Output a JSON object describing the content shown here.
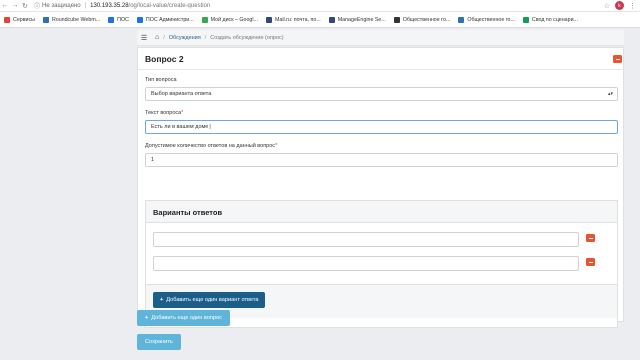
{
  "browser": {
    "security": "Не защищено",
    "url_host": "130.193.35.28",
    "url_path": "/og/local-value/create-question",
    "avatar_letter": "k"
  },
  "bookmarks": [
    {
      "label": "Сервисы",
      "color": "#e94235"
    },
    {
      "label": "Roundcube Webm...",
      "color": "#2f6fb5"
    },
    {
      "label": "ПОС",
      "color": "#1a73e8"
    },
    {
      "label": "ПОС Администри...",
      "color": "#1a73e8"
    },
    {
      "label": "Мой диск – Googl...",
      "color": "#34a853"
    },
    {
      "label": "Mail.ru: почта, по...",
      "color": "#2c4a7e"
    },
    {
      "label": "ManageEngine Se...",
      "color": "#2c4a7e"
    },
    {
      "label": "Общественное го...",
      "color": "#333333"
    },
    {
      "label": "Общественное го...",
      "color": "#2f6fb5"
    },
    {
      "label": "Свод по сценари...",
      "color": "#0f9d58"
    }
  ],
  "breadcrumb": {
    "link": "Обсуждения",
    "current": "Создать обсуждение (опрос)"
  },
  "question": {
    "title": "Вопрос 2",
    "type_label": "Тип вопроса",
    "type_value": "Выбор варианта ответа",
    "text_label": "Текст вопроса",
    "text_value": "Есть ли в вашем доме",
    "count_label": "Допустимое количество ответов на данный вопрос",
    "count_value": "1",
    "required_mark": "*"
  },
  "answers": {
    "title": "Варианты ответов",
    "add_label": "Добавить еще один вариант ответа"
  },
  "actions": {
    "add_question_label": "Добавить еще один вопрос",
    "save_label": "Сохранить"
  }
}
